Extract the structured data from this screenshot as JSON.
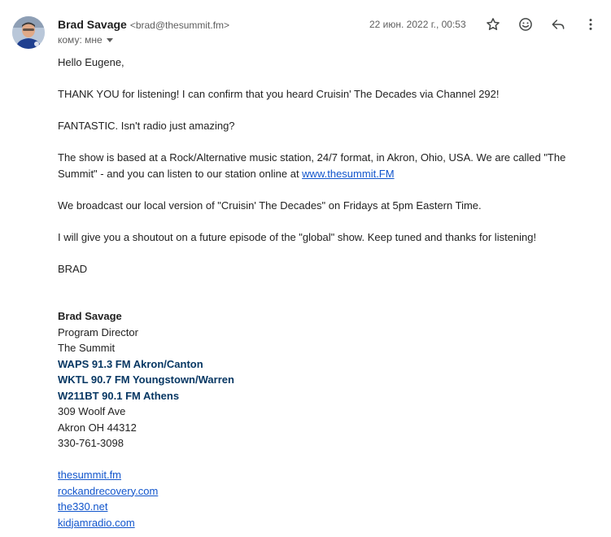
{
  "header": {
    "sender_name": "Brad Savage",
    "sender_email": "<brad@thesummit.fm>",
    "recipient_label": "кому: мне",
    "date": "22 июн. 2022 г., 00:53",
    "icons": {
      "star": "star-icon",
      "emoji": "emoji-icon",
      "reply": "reply-icon",
      "more": "more-vert-icon"
    }
  },
  "message": {
    "greeting": "Hello Eugene,",
    "p1": "THANK YOU for listening! I can confirm that you heard Cruisin' The Decades via Channel 292!",
    "p2": "FANTASTIC. Isn't radio just amazing?",
    "p3_text": "The show is based at a Rock/Alternative music station, 24/7 format, in Akron, Ohio, USA. We are called \"The Summit\" - and you can listen to our station online at ",
    "p3_link": "www.thesummit.FM",
    "p4": "We broadcast our local version of \"Cruisin' The Decades\" on Fridays at 5pm Eastern Time.",
    "p5": "I will give you a shoutout on a future episode of the \"global\" show. Keep tuned and thanks for listening!",
    "closing": "BRAD"
  },
  "signature": {
    "name": "Brad Savage",
    "title": "Program Director",
    "company": "The Summit",
    "stations": [
      "WAPS 91.3 FM Akron/Canton",
      "WKTL 90.7 FM Youngstown/Warren",
      "W211BT 90.1 FM Athens"
    ],
    "address1": "309 Woolf Ave",
    "address2": "Akron OH 44312",
    "phone": "330-761-3098",
    "links": [
      "thesummit.fm",
      "rockandrecovery.com",
      "the330.net",
      "kidjamradio.com"
    ]
  },
  "colors": {
    "link": "#1155cc",
    "station": "#073763",
    "text": "#222222",
    "muted": "#5e5e5e"
  }
}
